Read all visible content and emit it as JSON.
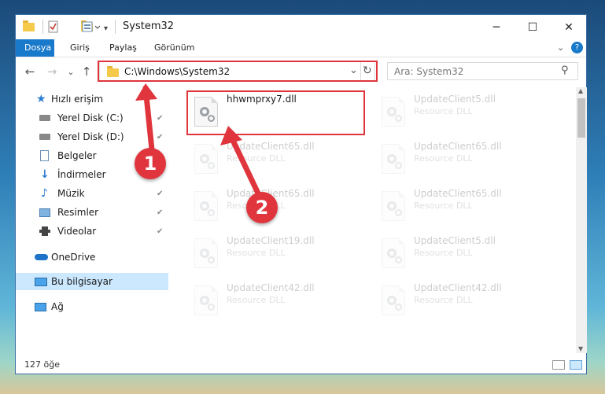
{
  "window": {
    "title": "System32",
    "controls": {
      "minimize": "─",
      "maximize": "☐",
      "close": "✕"
    }
  },
  "ribbon": {
    "tabs": [
      "Dosya",
      "Giriş",
      "Paylaş",
      "Görünüm"
    ],
    "expand_glyph": "⌄",
    "help_glyph": "?"
  },
  "nav": {
    "address": "C:\\Windows\\System32",
    "search_placeholder": "Ara: System32",
    "back_glyph": "←",
    "forward_glyph": "→",
    "recent_glyph": "⌄",
    "up_glyph": "↑",
    "refresh_glyph": "↻",
    "dropdown_glyph": "⌄",
    "search_glyph": "⚲"
  },
  "sidebar": {
    "items": [
      {
        "label": "Hızlı erişim",
        "icon": "star-icon",
        "pinned": false
      },
      {
        "label": "Yerel Disk (C:)",
        "icon": "drive-icon",
        "pinned": true
      },
      {
        "label": "Yerel Disk (D:)",
        "icon": "drive-icon",
        "pinned": true
      },
      {
        "label": "Belgeler",
        "icon": "document-icon",
        "pinned": true
      },
      {
        "label": "İndirmeler",
        "icon": "download-icon",
        "pinned": true
      },
      {
        "label": "Müzik",
        "icon": "music-icon",
        "pinned": true
      },
      {
        "label": "Resimler",
        "icon": "pictures-icon",
        "pinned": true
      },
      {
        "label": "Videolar",
        "icon": "video-icon",
        "pinned": true
      },
      {
        "label": "OneDrive",
        "icon": "cloud-icon",
        "pinned": false
      },
      {
        "label": "Bu bilgisayar",
        "icon": "computer-icon",
        "pinned": false
      },
      {
        "label": "Ağ",
        "icon": "network-icon",
        "pinned": false
      }
    ],
    "pin_glyph": "📌"
  },
  "files": [
    {
      "name": "hhwmprxy7.dll",
      "type": "",
      "highlighted": true
    },
    {
      "name": "UpdateClient5.dll",
      "type": "Resource DLL"
    },
    {
      "name": "UpdateClient65.dll",
      "type": "Resource DLL"
    },
    {
      "name": "UpdateClient65.dll",
      "type": "Resource DLL"
    },
    {
      "name": "UpdateClient65.dll",
      "type": "Resource DLL"
    },
    {
      "name": "UpdateClient65.dll",
      "type": "Resource DLL"
    },
    {
      "name": "UpdateClient19.dll",
      "type": "Resource DLL"
    },
    {
      "name": "UpdateClient5.dll",
      "type": "Resource DLL"
    },
    {
      "name": "UpdateClient42.dll",
      "type": "Resource DLL"
    },
    {
      "name": "UpdateClient42.dll",
      "type": "Resource DLL"
    }
  ],
  "status": {
    "item_count": "127 öğe"
  },
  "annotations": {
    "step1": "1",
    "step2": "2",
    "color": "#e0353d"
  }
}
